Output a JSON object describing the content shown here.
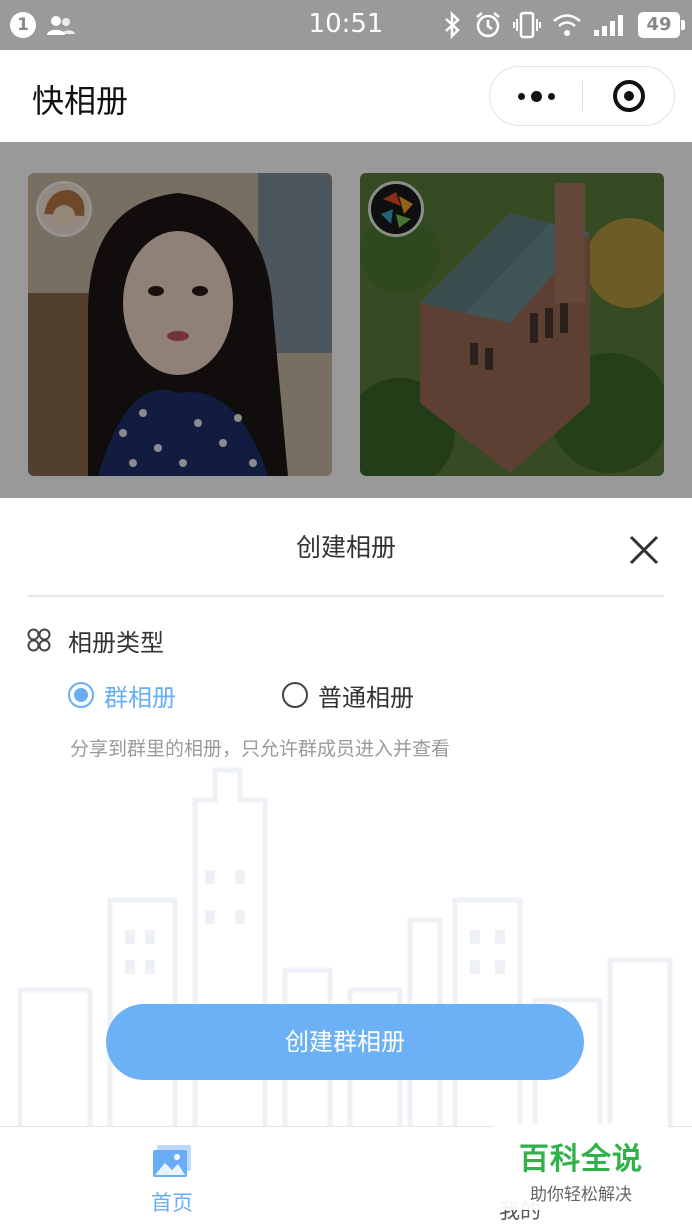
{
  "status_bar": {
    "notification_count": "1",
    "time": "10:51",
    "battery": "49",
    "icons": [
      "people-icon",
      "bluetooth-icon",
      "alarm-icon",
      "vibrate-icon",
      "wifi-icon",
      "signal-icon",
      "battery-icon"
    ]
  },
  "nav": {
    "title": "快相册",
    "more_icon": "more-dots-icon",
    "close_icon": "target-close-icon"
  },
  "gallery": {
    "albums": [
      {
        "title": "",
        "avatar_icon": "cartoon-avatar"
      },
      {
        "title": "",
        "avatar_icon": "colorful-avatar"
      }
    ]
  },
  "sheet": {
    "title": "创建相册",
    "close_icon": "close-icon",
    "type_label": "相册类型",
    "type_icon": "clover-icon",
    "options": [
      {
        "label": "群相册",
        "selected": true
      },
      {
        "label": "普通相册",
        "selected": false
      }
    ],
    "description": "分享到群里的相册，只允许群成员进入并查看",
    "button_label": "创建群相册"
  },
  "tabbar": {
    "home_label": "首页",
    "mine_label": "我的",
    "active_color": "#69aef5"
  },
  "watermark": {
    "title": "百科全说",
    "subtitle": "助你轻松解决"
  },
  "colors": {
    "accent": "#69aef5",
    "button": "#6cb0f5",
    "watermark_green": "#2fb24a"
  }
}
